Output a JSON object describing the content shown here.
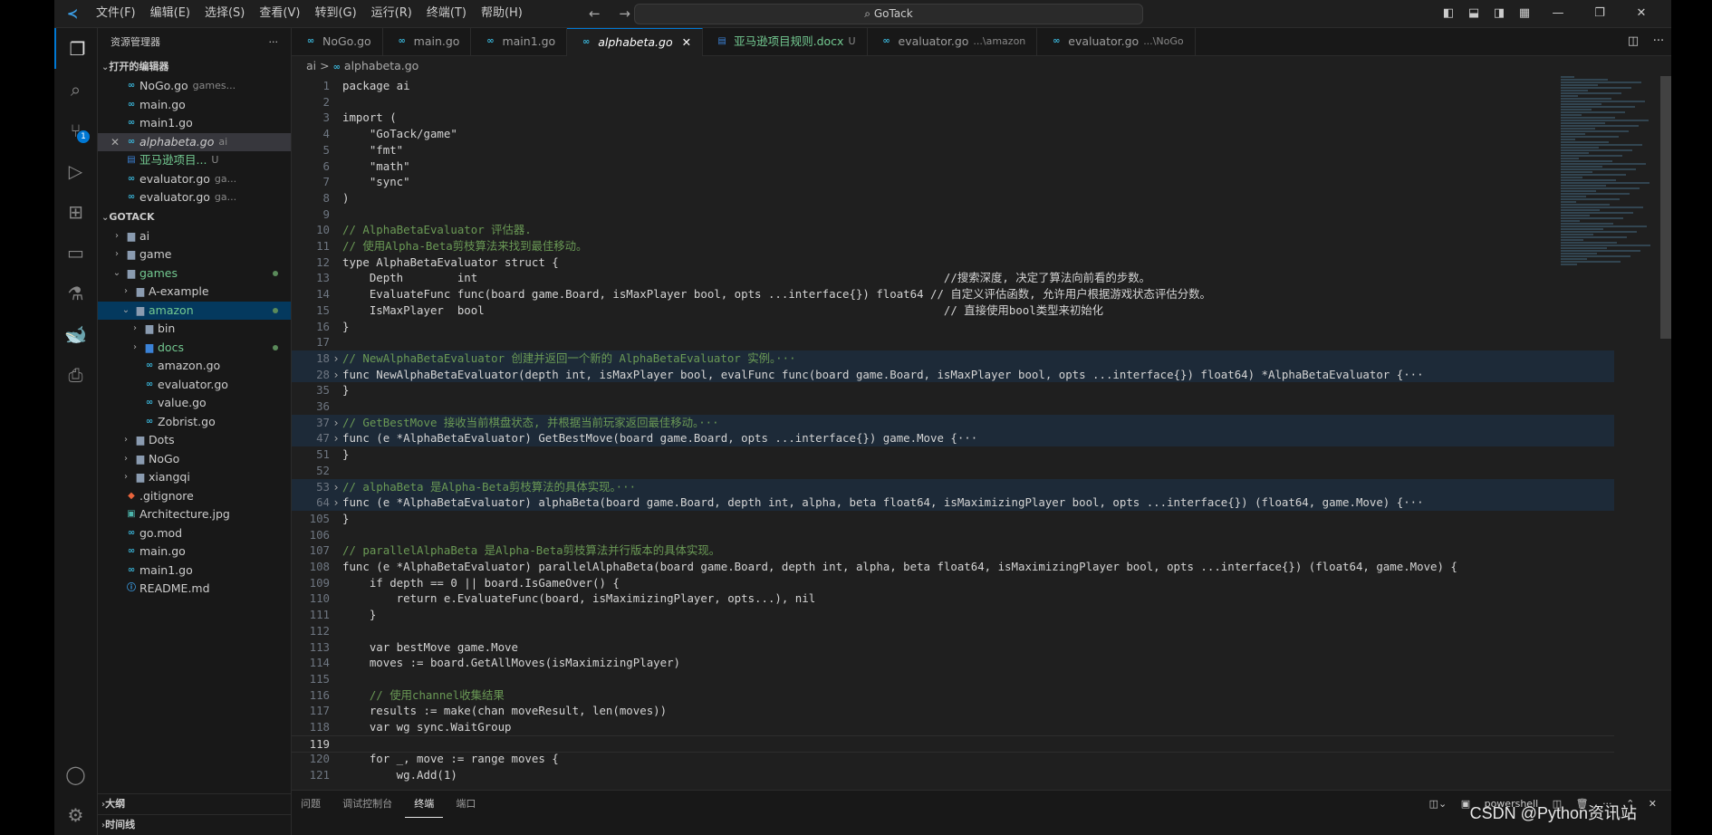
{
  "titlebar": {
    "menus": [
      "文件(F)",
      "编辑(E)",
      "选择(S)",
      "查看(V)",
      "转到(G)",
      "运行(R)",
      "终端(T)",
      "帮助(H)"
    ],
    "search": "GoTack"
  },
  "sidebar": {
    "title": "资源管理器",
    "more": "···",
    "open_editors_label": "打开的编辑器",
    "open_editors": [
      {
        "name": "NoGo.go",
        "hint": "games..."
      },
      {
        "name": "main.go",
        "hint": ""
      },
      {
        "name": "main1.go",
        "hint": ""
      },
      {
        "name": "alphabeta.go",
        "hint": "ai"
      },
      {
        "name": "亚马逊项目...",
        "hint": "U"
      },
      {
        "name": "evaluator.go",
        "hint": "ga..."
      },
      {
        "name": "evaluator.go",
        "hint": "ga..."
      }
    ],
    "project_label": "GOTACK",
    "tree": [
      {
        "name": "ai"
      },
      {
        "name": "game"
      },
      {
        "name": "games"
      },
      {
        "name": "A-example"
      },
      {
        "name": "amazon"
      },
      {
        "name": "bin"
      },
      {
        "name": "docs"
      },
      {
        "name": "amazon.go"
      },
      {
        "name": "evaluator.go"
      },
      {
        "name": "value.go"
      },
      {
        "name": "Zobrist.go"
      },
      {
        "name": "Dots"
      },
      {
        "name": "NoGo"
      },
      {
        "name": "xiangqi"
      },
      {
        "name": ".gitignore"
      },
      {
        "name": "Architecture.jpg"
      },
      {
        "name": "go.mod"
      },
      {
        "name": "main.go"
      },
      {
        "name": "main1.go"
      },
      {
        "name": "README.md"
      }
    ],
    "outline_label": "大纲",
    "timeline_label": "时间线"
  },
  "tabs": [
    {
      "label": "NoGo.go",
      "hint": ""
    },
    {
      "label": "main.go",
      "hint": ""
    },
    {
      "label": "main1.go",
      "hint": ""
    },
    {
      "label": "alphabeta.go",
      "hint": ""
    },
    {
      "label": "亚马逊项目规则.docx",
      "hint": "U"
    },
    {
      "label": "evaluator.go",
      "hint": "...\\amazon"
    },
    {
      "label": "evaluator.go",
      "hint": "...\\NoGo"
    }
  ],
  "breadcrumb": {
    "folder": "ai",
    "sep": ">",
    "file": "alphabeta.go"
  },
  "code": [
    {
      "n": "1",
      "t": "package ai"
    },
    {
      "n": "2",
      "t": ""
    },
    {
      "n": "3",
      "t": "import ("
    },
    {
      "n": "4",
      "t": "    \"GoTack/game\""
    },
    {
      "n": "5",
      "t": "    \"fmt\""
    },
    {
      "n": "6",
      "t": "    \"math\""
    },
    {
      "n": "7",
      "t": "    \"sync\""
    },
    {
      "n": "8",
      "t": ")"
    },
    {
      "n": "9",
      "t": ""
    },
    {
      "n": "10",
      "t": "// AlphaBetaEvaluator 评估器."
    },
    {
      "n": "11",
      "t": "// 使用Alpha-Beta剪枝算法来找到最佳移动。"
    },
    {
      "n": "12",
      "t": "type AlphaBetaEvaluator struct {"
    },
    {
      "n": "13",
      "t": "    Depth        int                                                                     //搜索深度, 决定了算法向前看的步数。"
    },
    {
      "n": "14",
      "t": "    EvaluateFunc func(board game.Board, isMaxPlayer bool, opts ...interface{}) float64 // 自定义评估函数, 允许用户根据游戏状态评估分数。"
    },
    {
      "n": "15",
      "t": "    IsMaxPlayer  bool                                                                    // 直接使用bool类型来初始化"
    },
    {
      "n": "16",
      "t": "}"
    },
    {
      "n": "17",
      "t": ""
    },
    {
      "n": "18",
      "t": "// NewAlphaBetaEvaluator 创建并返回一个新的 AlphaBetaEvaluator 实例。···"
    },
    {
      "n": "28",
      "t": "func NewAlphaBetaEvaluator(depth int, isMaxPlayer bool, evalFunc func(board game.Board, isMaxPlayer bool, opts ...interface{}) float64) *AlphaBetaEvaluator {···"
    },
    {
      "n": "35",
      "t": "}"
    },
    {
      "n": "36",
      "t": ""
    },
    {
      "n": "37",
      "t": "// GetBestMove 接收当前棋盘状态, 并根据当前玩家返回最佳移动。···"
    },
    {
      "n": "47",
      "t": "func (e *AlphaBetaEvaluator) GetBestMove(board game.Board, opts ...interface{}) game.Move {···"
    },
    {
      "n": "51",
      "t": "}"
    },
    {
      "n": "52",
      "t": ""
    },
    {
      "n": "53",
      "t": "// alphaBeta 是Alpha-Beta剪枝算法的具体实现。···"
    },
    {
      "n": "64",
      "t": "func (e *AlphaBetaEvaluator) alphaBeta(board game.Board, depth int, alpha, beta float64, isMaximizingPlayer bool, opts ...interface{}) (float64, game.Move) {···"
    },
    {
      "n": "105",
      "t": "}"
    },
    {
      "n": "106",
      "t": ""
    },
    {
      "n": "107",
      "t": "// parallelAlphaBeta 是Alpha-Beta剪枝算法并行版本的具体实现。"
    },
    {
      "n": "108",
      "t": "func (e *AlphaBetaEvaluator) parallelAlphaBeta(board game.Board, depth int, alpha, beta float64, isMaximizingPlayer bool, opts ...interface{}) (float64, game.Move) {"
    },
    {
      "n": "109",
      "t": "    if depth == 0 || board.IsGameOver() {"
    },
    {
      "n": "110",
      "t": "        return e.EvaluateFunc(board, isMaximizingPlayer, opts...), nil"
    },
    {
      "n": "111",
      "t": "    }"
    },
    {
      "n": "112",
      "t": ""
    },
    {
      "n": "113",
      "t": "    var bestMove game.Move"
    },
    {
      "n": "114",
      "t": "    moves := board.GetAllMoves(isMaximizingPlayer)"
    },
    {
      "n": "115",
      "t": ""
    },
    {
      "n": "116",
      "t": "    // 使用channel收集结果"
    },
    {
      "n": "117",
      "t": "    results := make(chan moveResult, len(moves))"
    },
    {
      "n": "118",
      "t": "    var wg sync.WaitGroup"
    },
    {
      "n": "119",
      "t": ""
    },
    {
      "n": "120",
      "t": "    for _, move := range moves {"
    },
    {
      "n": "121",
      "t": "        wg.Add(1)"
    }
  ],
  "panel": {
    "tabs": [
      "问题",
      "调试控制台",
      "终端",
      "端口"
    ],
    "terminal": "powershell"
  },
  "watermark": "CSDN @Python资讯站"
}
